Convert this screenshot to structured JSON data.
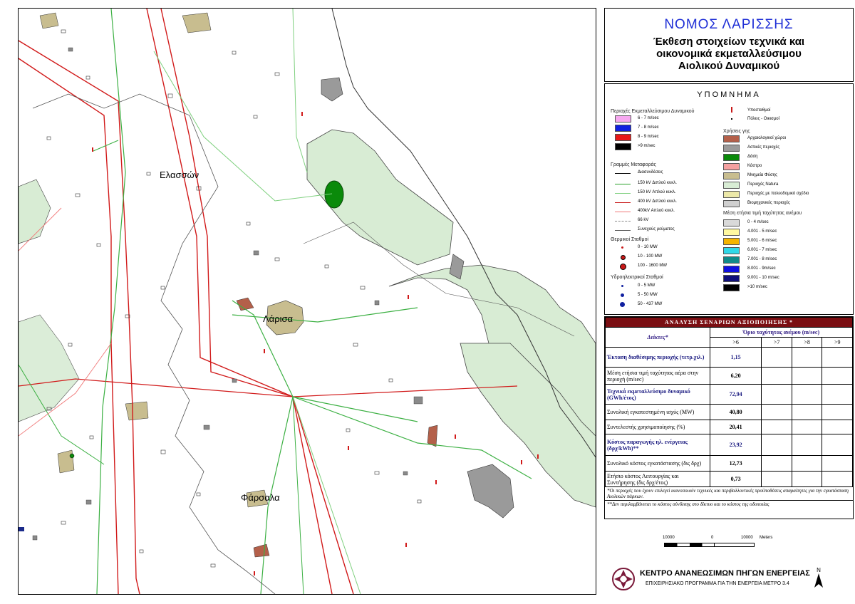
{
  "map": {
    "places": {
      "elassona": "Ελασσών",
      "larisa": "Λάρισα",
      "farsala": "Φάρσαλα"
    },
    "colors": {
      "natura": "#d8ecd4",
      "road_main": "#e0262b",
      "line_150": "#3cb043",
      "forest": "#0a8a0a",
      "archaeological": "#b4604a",
      "urban": "#9a9a9a",
      "monument": "#c8bd8f"
    }
  },
  "title": {
    "main": "ΝΟΜΟΣ ΛΑΡΙΣΣΗΣ",
    "line1": "Έκθεση στοιχείων τεχνικά και",
    "line2": "οικονομικά εκμεταλλεύσιμου",
    "line3": "Αιολικού Δυναμικού"
  },
  "legend": {
    "title": "ΥΠΟΜΝΗΜΑ",
    "areas_heading": "Περιοχές Εκμεταλλεύσιμου Δυναμικού",
    "areas": [
      {
        "label": "6 - 7 m/sec",
        "color": "#f7a8f0"
      },
      {
        "label": "7 - 8 m/sec",
        "color": "#1020e0"
      },
      {
        "label": "8 - 9 m/sec",
        "color": "#e81818"
      },
      {
        "label": ">9 m/sec",
        "color": "#000000"
      }
    ],
    "lines_heading": "Γραμμές Μεταφοράς",
    "lines": [
      {
        "label": "Διασυνδέσεις",
        "color": "#000000",
        "style": "solid"
      },
      {
        "label": "150 kV Διπλού κυκλ.",
        "color": "#2aa02a",
        "style": "solid"
      },
      {
        "label": "150 kV Απλού κυκλ.",
        "color": "#7fd07f",
        "style": "solid"
      },
      {
        "label": "400 kV Διπλού κυκλ.",
        "color": "#c81818",
        "style": "solid"
      },
      {
        "label": "400kV Απλού κυκλ.",
        "color": "#f07a7a",
        "style": "solid"
      },
      {
        "label": "66 kV",
        "color": "#888888",
        "style": "dashed"
      },
      {
        "label": "Συνεχούς ρεύματος",
        "color": "#555555",
        "style": "solid"
      }
    ],
    "thermal_heading": "Θερμικοί Σταθμοί",
    "thermal": [
      {
        "label": "0 - 10 MW"
      },
      {
        "label": "10 - 100 MW"
      },
      {
        "label": "100 - 1600 MW"
      }
    ],
    "hydro_heading": "Υδροηλεκτρικοί Σταθμοί",
    "hydro": [
      {
        "label": "0 - 5 MW"
      },
      {
        "label": "5 - 50 MW"
      },
      {
        "label": "50 - 437 MW"
      }
    ],
    "substations": "Υποσταθμοί",
    "cities": "Πόλεις - Οικισμοί",
    "landuse_heading": "Χρήσεις γης",
    "landuse": [
      {
        "label": "Αρχαιολογικοί χώροι",
        "color": "#b4604a"
      },
      {
        "label": "Αστικές περιοχές",
        "color": "#9a9a9a"
      },
      {
        "label": "Δάση",
        "color": "#0a8a0a"
      },
      {
        "label": "Κάστρο",
        "color": "#f4a0a0"
      },
      {
        "label": "Μνημεία Φύσης",
        "color": "#c8bd8f"
      },
      {
        "label": "Περιοχές Natura",
        "color": "#d8ecd4"
      },
      {
        "label": "Περιοχές με πολεοδομικό σχέδιο",
        "color": "#ece8a8"
      },
      {
        "label": "Βιομηχανικές περιοχές",
        "color": "#cfcfcf"
      }
    ],
    "wind_heading": "Μέση ετήσια τιμή ταχύτητας ανέμου",
    "wind": [
      {
        "label": "0 - 4 m/sec",
        "color": "#d9d9d9"
      },
      {
        "label": "4.001 - 5 m/sec",
        "color": "#fff8a0"
      },
      {
        "label": "5.001 - 6 m/sec",
        "color": "#f5b400"
      },
      {
        "label": "6.001 - 7 m/sec",
        "color": "#30d8e8"
      },
      {
        "label": "7.001 - 8 m/sec",
        "color": "#108a8a"
      },
      {
        "label": "8.001 - 9m/sec",
        "color": "#1010e0"
      },
      {
        "label": "9.001 - 10 m/sec",
        "color": "#10107a"
      },
      {
        "label": ">10 m/sec",
        "color": "#000000"
      }
    ]
  },
  "scenario": {
    "title": "ΑΝΑΛΥΣΗ ΣΕΝΑΡΙΩΝ ΑΞΙΟΠΟΙΗΣΗΣ *",
    "col_indicators": "Δείκτες*",
    "col_threshold": "Όριο ταχύτητας ανέμου (m/sec)",
    "thresholds": [
      ">6",
      ">7",
      ">8",
      ">9"
    ],
    "rows": [
      {
        "label": "Έκταση διαθέσιμης περιοχής (τετρ.χιλ.)",
        "value": "1,15",
        "bold": true
      },
      {
        "label": "Μέση ετήσια τιμή ταχύτητας αέρα στην περιοχή (m/sec)",
        "value": "6,20",
        "bold": false
      },
      {
        "label": "Τεχνικά εκμεταλλεύσιμο δυναμικό (GWh/έτος)",
        "value": "72,94",
        "bold": true
      },
      {
        "label": "Συνολική εγκατεστημένη ισχύς (MW)",
        "value": "40,80",
        "bold": false
      },
      {
        "label": "Συντελεστής χρησιμοποίησης (%)",
        "value": "20,41",
        "bold": false
      },
      {
        "label": "Κόστος παραγωγής ηλ. ενέργειας (δρχ/kWh)**",
        "value": "23,92",
        "bold": true
      },
      {
        "label": "Συνολικό κόστος εγκατάστασης (δις δρχ)",
        "value": "12,73",
        "bold": false
      },
      {
        "label": "Ετήσιο κόστος Λειτουργίας και Συντήρησης (δις δρχ/έτος)",
        "value": "0,73",
        "bold": false
      }
    ],
    "note1": "*Οι περιοχές που έχουν επιλεγεί ικανοποιούν τεχνικές και περιβαλλοντικές προϋποθέσεις απαραίτητες για την εγκατάσταση Αιολικών πάρκων.",
    "note2": "**Δεν περιλαμβάνεται το κόστος σύνδεσης στο δίκτυο και το κόστος της οδοποιίας"
  },
  "scale": {
    "left": "10000",
    "mid": "0",
    "right": "10000",
    "unit": "Meters"
  },
  "footer": {
    "org": "ΚΕΝΤΡΟ ΑΝΑΝΕΩΣΙΜΩΝ ΠΗΓΩΝ ΕΝΕΡΓΕΙΑΣ",
    "program": "ΕΠΙΧΕΙΡΗΣΙΑΚΟ ΠΡΟΓΡΑΜΜΑ ΓΙΑ ΤΗΝ ΕΝΕΡΓΕΙΑ ΜΕΤΡΟ 3.4",
    "north": "N"
  }
}
